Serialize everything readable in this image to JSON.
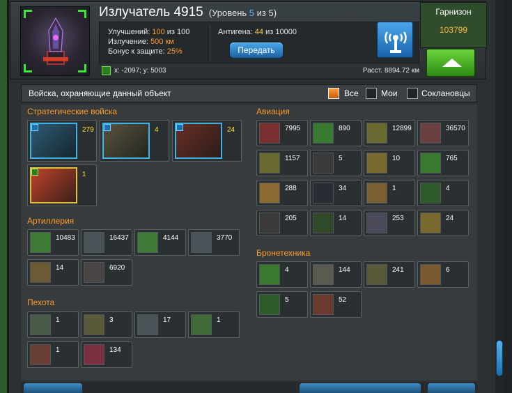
{
  "header": {
    "title": "Излучатель 4915",
    "level_prefix": "(Уровень",
    "level_cur": "5",
    "level_suffix": "из 5)",
    "upgrades_label": "Улучшений:",
    "upgrades_value": "100",
    "upgrades_max": "из 100",
    "emission_label": "Излучение:",
    "emission_value": "500 км",
    "defense_label": "Бонус к защите:",
    "defense_value": "25%",
    "antigen_label": "Антигена:",
    "antigen_value": "44",
    "antigen_max": "из 10000",
    "transfer_button": "Передать",
    "coords": "x: -2097; y: 5003",
    "distance": "Расст. 8894.72 км",
    "garrison_label": "Гарнизон",
    "garrison_value": "103799"
  },
  "filter": {
    "caption": "Войска, охраняющие данный объект",
    "options": [
      "Все",
      "Мои",
      "Соклановцы"
    ],
    "selected": "Все"
  },
  "sections": {
    "strategic": {
      "title": "Стратегические войска",
      "units": [
        "279",
        "4",
        "24",
        "1"
      ]
    },
    "artillery": {
      "title": "Артиллерия",
      "units": [
        "10483",
        "16437",
        "4144",
        "3770",
        "14",
        "6920"
      ]
    },
    "infantry": {
      "title": "Пехота",
      "units": [
        "1",
        "3",
        "17",
        "1",
        "1",
        "134"
      ]
    },
    "aviation": {
      "title": "Авиация",
      "units": [
        "7995",
        "890",
        "12899",
        "36570",
        "1157",
        "5",
        "10",
        "765",
        "288",
        "34",
        "1",
        "4",
        "205",
        "14",
        "253",
        "24"
      ]
    },
    "armor": {
      "title": "Бронетехника",
      "units": [
        "4",
        "144",
        "241",
        "6",
        "5",
        "52"
      ]
    }
  },
  "colors": {
    "accent_orange": "#ff9b2a",
    "accent_blue": "#3cb4e6",
    "accent_green": "#3ee83a",
    "count_yellow": "#ffe02e"
  }
}
